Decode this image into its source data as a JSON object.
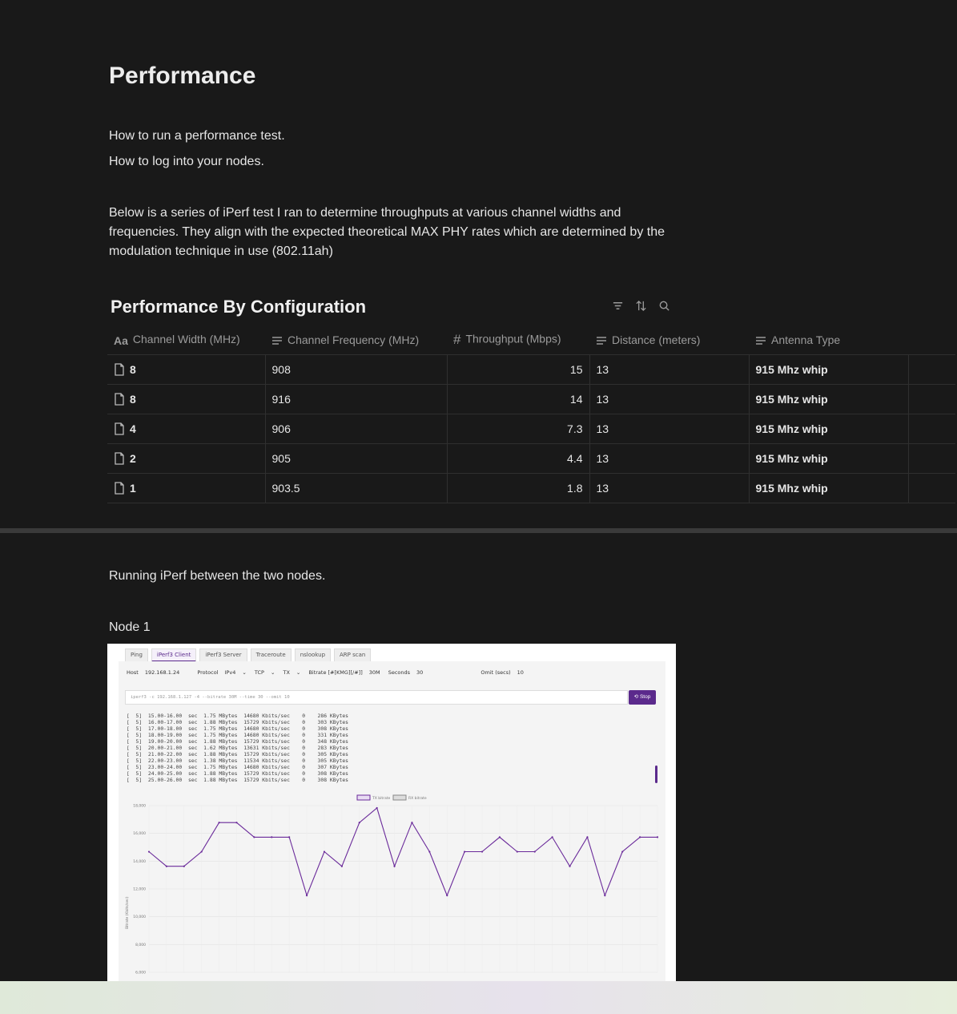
{
  "page": {
    "title": "Performance",
    "links": [
      "How to run a performance test.",
      "How to log into your nodes."
    ],
    "intro": "Below is a series of iPerf test I ran to determine throughputs at various channel widths and frequencies. They align with the expected theoretical MAX PHY rates which are determined by the modulation technique in use (802.11ah)",
    "running_text": "Running iPerf between the two nodes.",
    "node_label": "Node 1"
  },
  "database": {
    "title": "Performance By Configuration",
    "columns": [
      "Channel Width (MHz)",
      "Channel Frequency (MHz)",
      "Throughput (Mbps)",
      "Distance (meters)",
      "Antenna Type"
    ],
    "column_icons": [
      "title-icon",
      "text-icon",
      "number-icon",
      "text-icon",
      "text-icon"
    ],
    "rows": [
      {
        "width": "8",
        "freq": "908",
        "throughput": "15",
        "distance": "13",
        "antenna": "915 Mhz whip"
      },
      {
        "width": "8",
        "freq": "916",
        "throughput": "14",
        "distance": "13",
        "antenna": "915 Mhz whip"
      },
      {
        "width": "4",
        "freq": "906",
        "throughput": "7.3",
        "distance": "13",
        "antenna": "915 Mhz whip"
      },
      {
        "width": "2",
        "freq": "905",
        "throughput": "4.4",
        "distance": "13",
        "antenna": "915 Mhz whip"
      },
      {
        "width": "1",
        "freq": "903.5",
        "throughput": "1.8",
        "distance": "13",
        "antenna": "915 Mhz whip"
      }
    ]
  },
  "iperf": {
    "tabs": [
      "Ping",
      "iPerf3 Client",
      "iPerf3 Server",
      "Traceroute",
      "nslookup",
      "ARP scan"
    ],
    "active_tab": 1,
    "host_label": "Host",
    "host_value": "192.168.1.24",
    "protocol_label": "Protocol",
    "protocol_value": "IPv4",
    "transport_value": "TCP",
    "direction_value": "TX",
    "bitrate_label": "Bitrate [#[KMG][/#]]",
    "bitrate_value": "30M",
    "seconds_label": "Seconds",
    "seconds_value": "30",
    "omit_label": "Omit (secs)",
    "omit_value": "10",
    "command": "iperf3 -c 192.168.1.127 -4 --bitrate 30M --time 30 --omit 10",
    "stop_label": "Stop",
    "log": "[  5]  15.00-16.00  sec  1.75 MBytes  14680 Kbits/sec    0    286 KBytes\n[  5]  16.00-17.00  sec  1.88 MBytes  15729 Kbits/sec    0    303 KBytes\n[  5]  17.00-18.00  sec  1.75 MBytes  14680 Kbits/sec    0    308 KBytes\n[  5]  18.00-19.00  sec  1.75 MBytes  14680 Kbits/sec    0    331 KBytes\n[  5]  19.00-20.00  sec  1.88 MBytes  15729 Kbits/sec    0    348 KBytes\n[  5]  20.00-21.00  sec  1.62 MBytes  13631 Kbits/sec    0    283 KBytes\n[  5]  21.00-22.00  sec  1.88 MBytes  15729 Kbits/sec    0    305 KBytes\n[  5]  22.00-23.00  sec  1.38 MBytes  11534 Kbits/sec    0    305 KBytes\n[  5]  23.00-24.00  sec  1.75 MBytes  14680 Kbits/sec    0    307 KBytes\n[  5]  24.00-25.00  sec  1.88 MBytes  15729 Kbits/sec    0    308 KBytes\n[  5]  25.00-26.00  sec  1.88 MBytes  15729 Kbits/sec    0    308 KBytes",
    "colors": {
      "accent": "#5b2a8c",
      "line": "#6a2a9a"
    }
  },
  "chart_data": {
    "type": "line",
    "ylabel": "Bitrate (Kbits/sec)",
    "yticks": [
      "18,000",
      "16,000",
      "14,000",
      "12,000",
      "10,000",
      "8,000",
      "6,000"
    ],
    "ylim": [
      6000,
      18000
    ],
    "legend": [
      "TX bitrate",
      "RX bitrate"
    ],
    "series": [
      {
        "name": "TX bitrate",
        "color": "#6a2a9a",
        "values": [
          14680,
          13631,
          13631,
          14680,
          16777,
          16777,
          15729,
          15729,
          15729,
          11534,
          14680,
          13631,
          16777,
          17825,
          13631,
          16777,
          14680,
          11534,
          14680,
          14680,
          15729,
          14680,
          14680,
          15729,
          13631,
          15729,
          11534,
          14680,
          15729,
          15729
        ]
      }
    ]
  }
}
